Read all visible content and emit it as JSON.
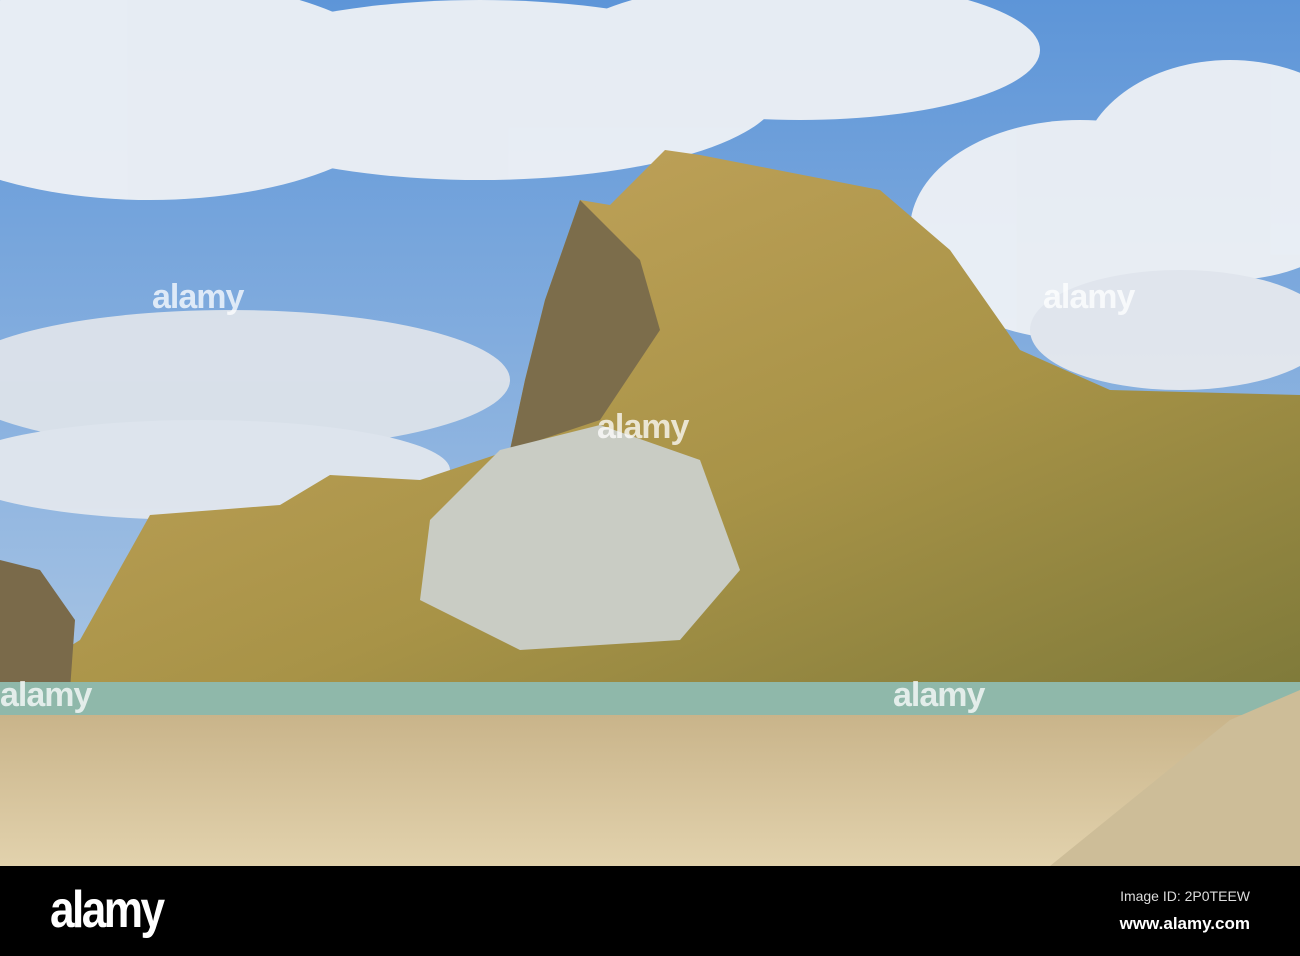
{
  "watermark": {
    "text": "alamy"
  },
  "footer": {
    "logo": "alamy",
    "image_id": "Image ID: 2P0TEEW",
    "website": "www.alamy.com"
  },
  "colors": {
    "sky": "#6fa3dc",
    "cloud": "#f2f4f7",
    "hill": "#b59b52",
    "cliff": "#8c7a55",
    "water": "#8fb8aa",
    "sand": "#d8c59c",
    "bar": "#000000"
  }
}
